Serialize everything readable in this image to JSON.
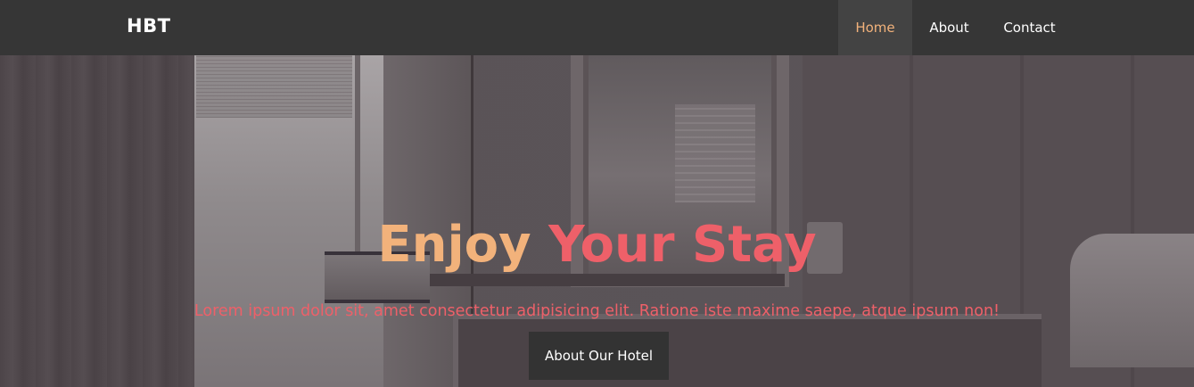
{
  "navbar": {
    "brand": "HBT",
    "links": [
      {
        "label": "Home",
        "active": true
      },
      {
        "label": "About",
        "active": false
      },
      {
        "label": "Contact",
        "active": false
      }
    ]
  },
  "hero": {
    "title_part1": "Enjoy",
    "title_part2": "Your Stay",
    "subtitle": "Lorem ipsum dolor sit, amet consectetur adipisicing elit. Ratione iste maxime saepe, atque ipsum non!",
    "button_label": "About Our Hotel"
  },
  "colors": {
    "navbar_bg": "#363636",
    "active_link": "#f2b27b",
    "accent_orange": "#f2b27b",
    "accent_red": "#ee6069",
    "button_bg": "#333333"
  }
}
